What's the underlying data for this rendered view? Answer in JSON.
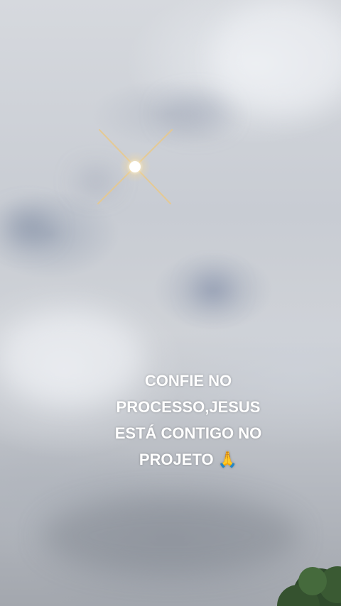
{
  "caption": {
    "line1": "CONFIE NO",
    "line2": "PROCESSO,JESUS",
    "line3": "ESTÁ CONTIGO NO",
    "line4": "PROJETO 🙏"
  },
  "colors": {
    "sky": "#c9ccd1",
    "sun": "#fff6d8",
    "flare": "#e9c98a",
    "caption_text": "#ffffff",
    "tree": "#2f4a2c"
  }
}
